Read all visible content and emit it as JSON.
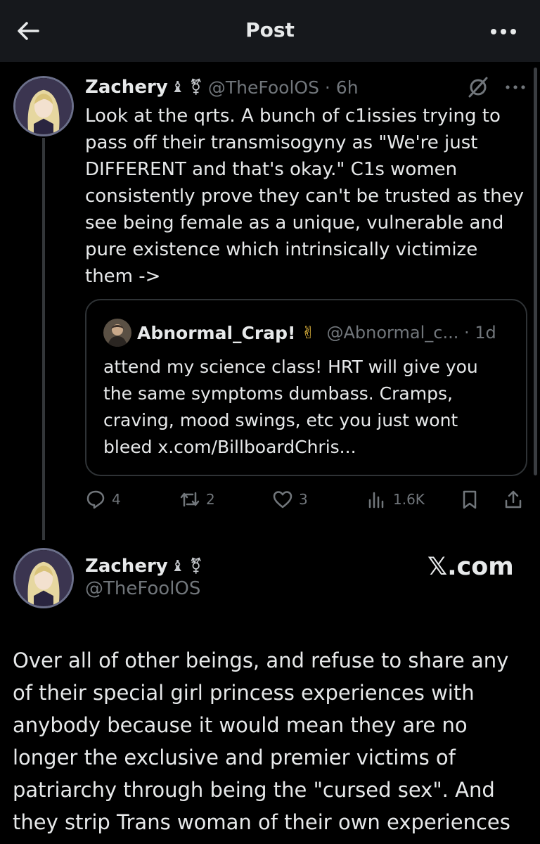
{
  "header": {
    "title": "Post",
    "back_icon": "arrow-left-icon",
    "more_icon": "more-horizontal-icon"
  },
  "tweet1": {
    "name": "Zachery",
    "badge": "♝ ⚧",
    "handle": "@TheFoolOS · 6h",
    "text": "Look at the qrts. A bunch of c1issies trying to\npass off their transmisogyny as \"We're just\nDIFFERENT and that's okay.\" C1s women\nconsistently prove they can't be trusted as they\nsee being female as a unique, vulnerable and\npure existence which intrinsically victimize\nthem ->",
    "quote": {
      "name": "Abnormal_Crap!",
      "emoji": "✌",
      "handle": "@Abnormal_c... · 1d",
      "text": "attend my science class! HRT will give you\nthe same symptoms dumbass. Cramps,\ncraving, mood swings, etc you just wont\nbleed x.com/BillboardChris..."
    },
    "actions": {
      "replies": "4",
      "reposts": "2",
      "likes": "3",
      "views": "1.6K"
    }
  },
  "tweet2": {
    "name": "Zachery",
    "badge": "♝ ⚧",
    "handle": "@TheFoolOS",
    "brand": "𝕏.com",
    "text": "Over all of other beings, and refuse to share any\nof their special girl princess experiences with\nanybody because it would mean they are no\nlonger the exclusive and premier victims of\npatriarchy through being the \"cursed sex\". And\nthey strip Trans woman of their own experiences"
  },
  "colors": {
    "background": "#000000",
    "header": "#16181c",
    "text": "#e7e9ea",
    "muted": "#71767b",
    "border": "#2f3336"
  }
}
